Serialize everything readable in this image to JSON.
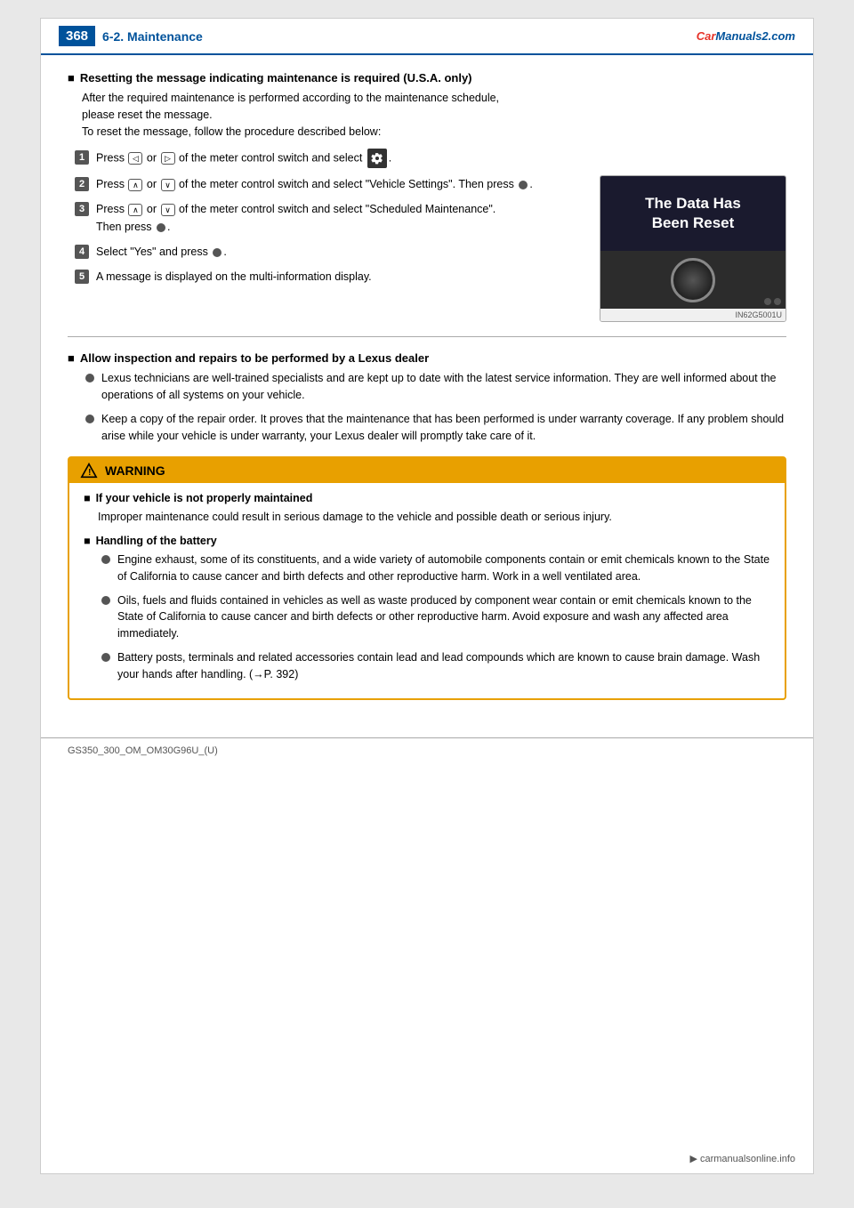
{
  "header": {
    "logo_car": "Car",
    "logo_manuals": "Manuals2.com",
    "page_number": "368",
    "section": "6-2. Maintenance"
  },
  "resetting_section": {
    "title": "Resetting the message indicating maintenance is required (U.S.A. only)",
    "intro_lines": [
      "After the required maintenance is performed according to the maintenance schedule,",
      "please reset the message.",
      "To reset the message, follow the procedure described below:"
    ],
    "steps": [
      {
        "num": "1",
        "text": "Press  ◁  or  ▷  of the meter control switch and select",
        "has_gear": true,
        "gear_suffix": "."
      },
      {
        "num": "2",
        "text": "Press  ∧  or  ∨  of the meter control switch and select \"Vehicle Settings\". Then press",
        "has_dot_end": true
      },
      {
        "num": "3",
        "text": "Press  ∧  or  ∨  of the meter control switch and select \"Scheduled Maintenance\".",
        "then_press": "Then press"
      },
      {
        "num": "4",
        "text": "Select \"Yes\" and press"
      },
      {
        "num": "5",
        "text": "A message is displayed on the multi-information display."
      }
    ]
  },
  "display_image": {
    "text_line1": "The Data Has",
    "text_line2": "Been Reset",
    "caption": "IN62G5001U"
  },
  "allow_section": {
    "title": "Allow inspection and repairs to be performed by a Lexus dealer",
    "bullets": [
      "Lexus technicians are well-trained specialists and are kept up to date with the latest service information. They are well informed about the operations of all systems on your vehicle.",
      "Keep a copy of the repair order. It proves that the maintenance that has been performed is under warranty coverage. If any problem should arise while your vehicle is under warranty, your Lexus dealer will promptly take care of it."
    ]
  },
  "warning": {
    "label": "WARNING",
    "subsections": [
      {
        "title": "If your vehicle is not properly maintained",
        "text": "Improper maintenance could result in serious damage to the vehicle and possible death or serious injury."
      },
      {
        "title": "Handling of the battery",
        "bullets": [
          "Engine exhaust, some of its constituents, and a wide variety of automobile components contain or emit chemicals known to the State of California to cause cancer and birth defects and other reproductive harm. Work in a well ventilated area.",
          "Oils, fuels and fluids contained in vehicles as well as waste produced by component wear contain or emit chemicals known to the State of California to cause cancer and birth defects or other reproductive harm. Avoid exposure and wash any affected area immediately.",
          "Battery posts, terminals and related accessories contain lead and lead compounds which are known to cause brain damage. Wash your hands after handling. (→P. 392)"
        ]
      }
    ]
  },
  "footer": {
    "model": "GS350_300_OM_OM30G96U_(U)"
  }
}
